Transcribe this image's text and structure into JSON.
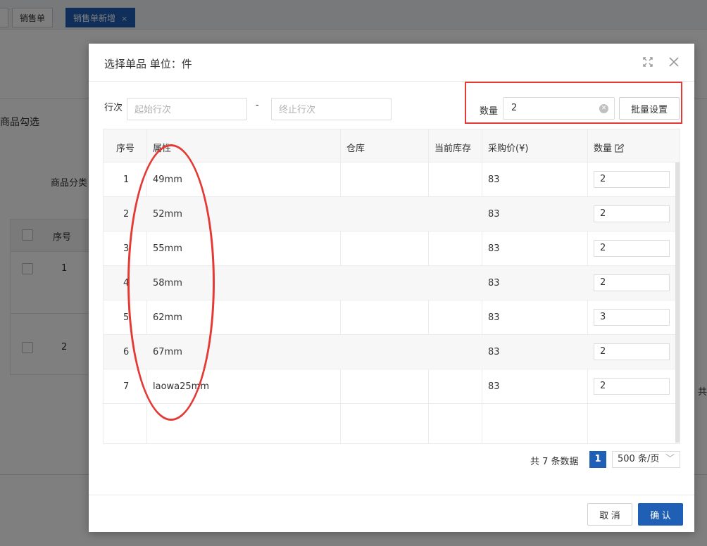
{
  "background": {
    "tabs": [
      "销售单",
      "销售单新增"
    ],
    "tab_close": "×",
    "panel_title": "商品勾选",
    "category_label": "商品分类",
    "seq_header": "序号",
    "rows": [
      "1",
      "2"
    ],
    "footer_text": "共"
  },
  "modal": {
    "title": "选择单品 单位：件",
    "row_range_label": "行次",
    "start_placeholder": "起始行次",
    "range_separator": "-",
    "end_placeholder": "终止行次",
    "qty_label": "数量",
    "qty_value": "2",
    "batch_button": "批量设置",
    "columns": [
      "序号",
      "属性",
      "仓库",
      "当前库存",
      "采购价(¥)",
      "数量"
    ],
    "rows": [
      {
        "seq": "1",
        "attr": "49mm",
        "warehouse": "",
        "stock": "",
        "price": "83",
        "qty": "2"
      },
      {
        "seq": "2",
        "attr": "52mm",
        "warehouse": "",
        "stock": "",
        "price": "83",
        "qty": "2"
      },
      {
        "seq": "3",
        "attr": "55mm",
        "warehouse": "",
        "stock": "",
        "price": "83",
        "qty": "2"
      },
      {
        "seq": "4",
        "attr": "58mm",
        "warehouse": "",
        "stock": "",
        "price": "83",
        "qty": "2"
      },
      {
        "seq": "5",
        "attr": "62mm",
        "warehouse": "",
        "stock": "",
        "price": "83",
        "qty": "3"
      },
      {
        "seq": "6",
        "attr": "67mm",
        "warehouse": "",
        "stock": "",
        "price": "83",
        "qty": "2"
      },
      {
        "seq": "7",
        "attr": "laowa25mm",
        "warehouse": "",
        "stock": "",
        "price": "83",
        "qty": "2"
      }
    ],
    "pager_total": "共 7 条数据",
    "pager_page": "1",
    "pager_size": "500 条/页",
    "cancel_button": "取 消",
    "confirm_button": "确 认"
  },
  "colors": {
    "primary": "#1f5fb5",
    "annotation": "#e53935"
  },
  "icons": [
    "fullscreen-icon",
    "close-icon",
    "clear-icon",
    "edit-icon",
    "chevron-down-icon"
  ]
}
